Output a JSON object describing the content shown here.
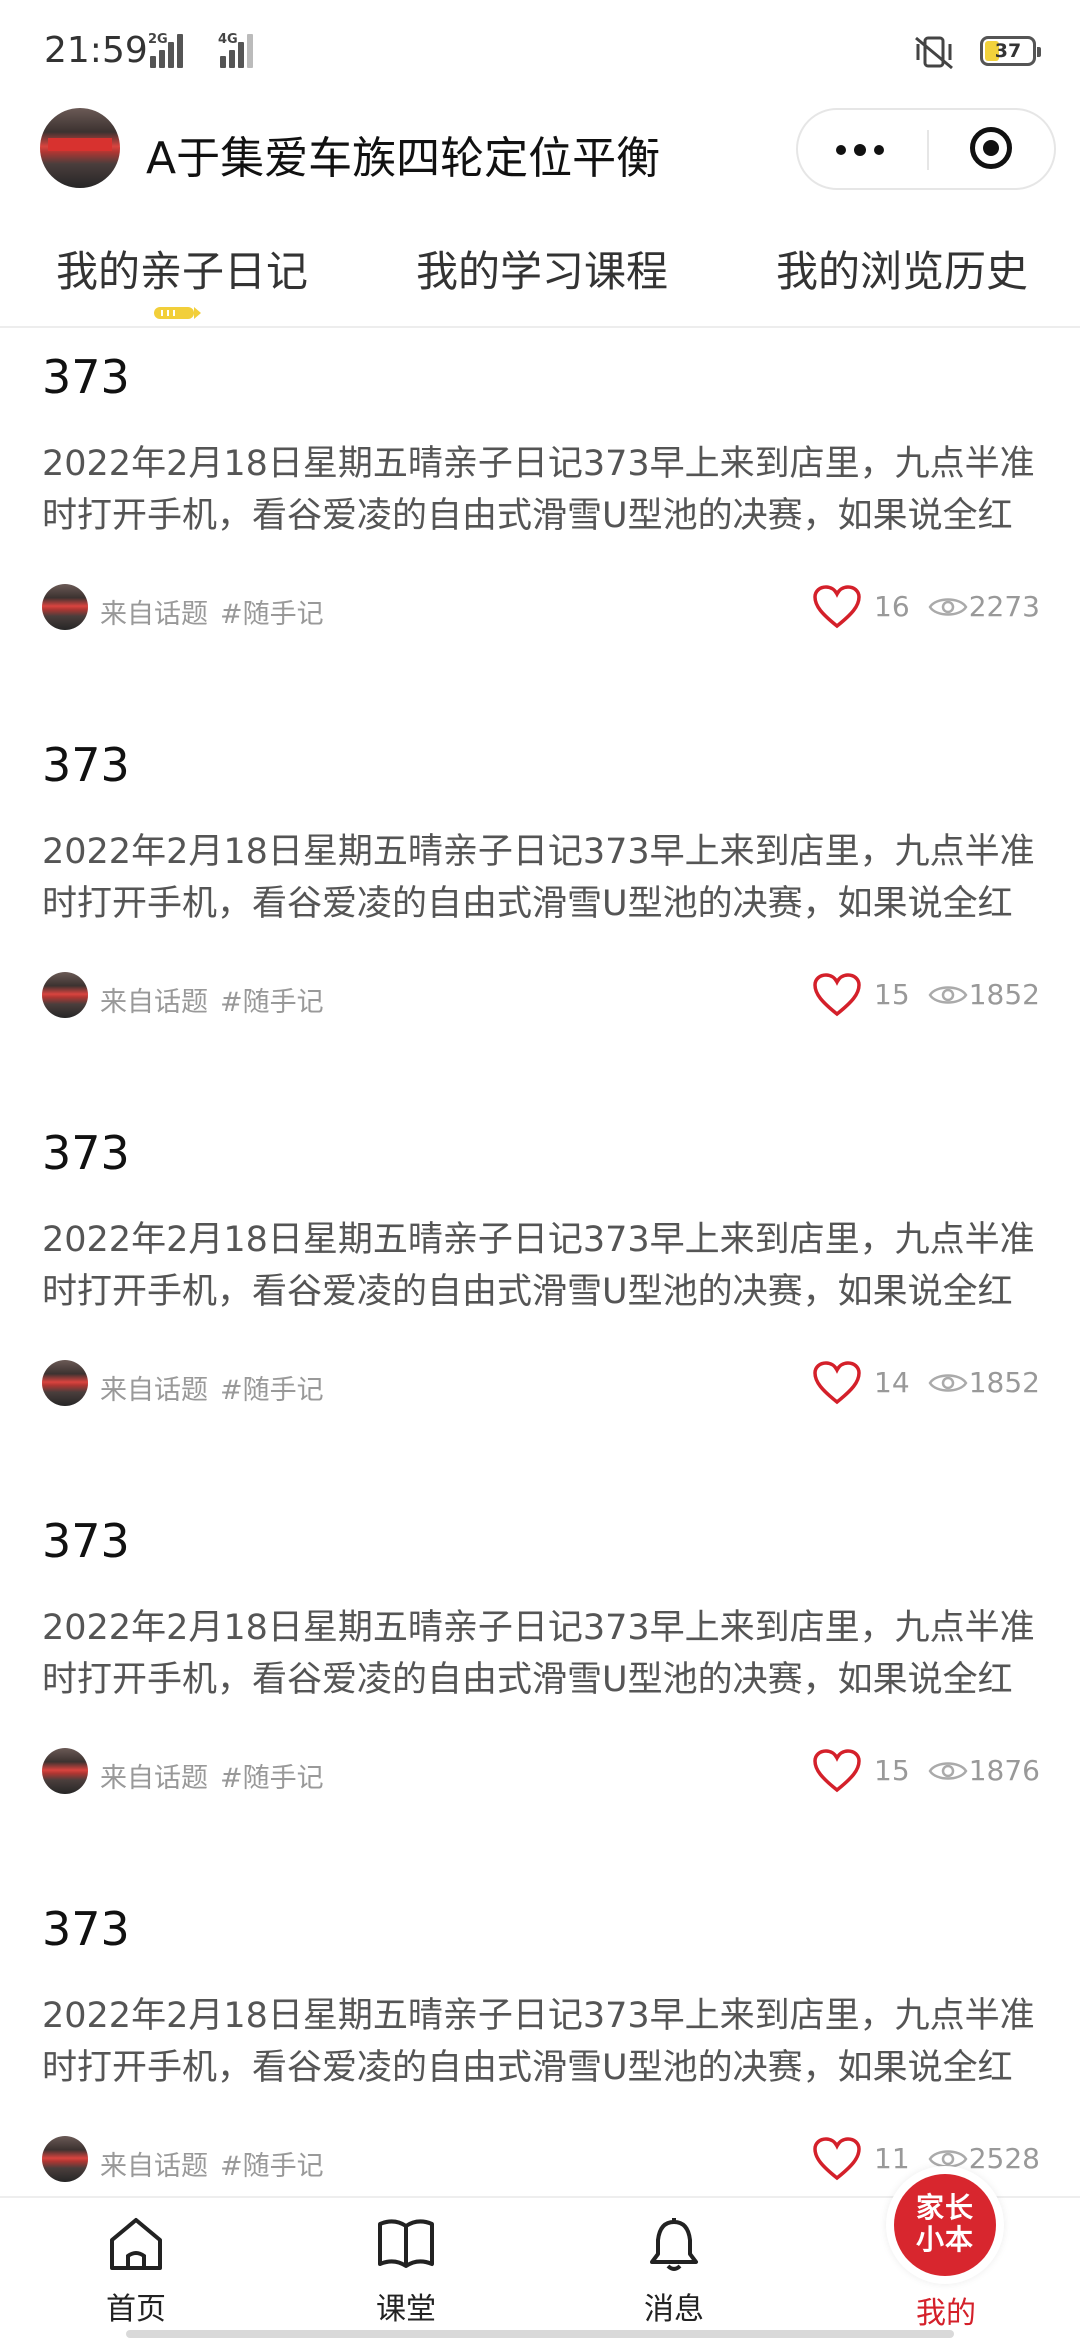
{
  "status_bar": {
    "time": "21:59",
    "network_1": "2G",
    "network_2": "4G",
    "battery": "37"
  },
  "header": {
    "title": "A于集爱车族四轮定位平衡"
  },
  "tabs": [
    {
      "label": "我的亲子日记",
      "active": true
    },
    {
      "label": "我的学习课程",
      "active": false
    },
    {
      "label": "我的浏览历史",
      "active": false
    }
  ],
  "posts": [
    {
      "title": "373",
      "excerpt": "2022年2月18日星期五晴亲子日记373早上来到店里，九点半准时打开手机，看谷爱凌的自由式滑雪U型池的决赛，如果说全红",
      "source": "来自话题",
      "topic": "#随手记",
      "likes": "16",
      "views": "2273"
    },
    {
      "title": "373",
      "excerpt": "2022年2月18日星期五晴亲子日记373早上来到店里，九点半准时打开手机，看谷爱凌的自由式滑雪U型池的决赛，如果说全红",
      "source": "来自话题",
      "topic": "#随手记",
      "likes": "15",
      "views": "1852"
    },
    {
      "title": "373",
      "excerpt": "2022年2月18日星期五晴亲子日记373早上来到店里，九点半准时打开手机，看谷爱凌的自由式滑雪U型池的决赛，如果说全红",
      "source": "来自话题",
      "topic": "#随手记",
      "likes": "14",
      "views": "1852"
    },
    {
      "title": "373",
      "excerpt": "2022年2月18日星期五晴亲子日记373早上来到店里，九点半准时打开手机，看谷爱凌的自由式滑雪U型池的决赛，如果说全红",
      "source": "来自话题",
      "topic": "#随手记",
      "likes": "15",
      "views": "1876"
    },
    {
      "title": "373",
      "excerpt": "2022年2月18日星期五晴亲子日记373早上来到店里，九点半准时打开手机，看谷爱凌的自由式滑雪U型池的决赛，如果说全红",
      "source": "来自话题",
      "topic": "#随手记",
      "likes": "11",
      "views": "2528"
    }
  ],
  "bottom_nav": [
    {
      "label": "首页",
      "icon": "home-icon"
    },
    {
      "label": "课堂",
      "icon": "book-icon"
    },
    {
      "label": "消息",
      "icon": "bell-icon"
    },
    {
      "label": "我的",
      "icon": "brand-logo",
      "active": true
    }
  ],
  "brand": {
    "line1": "家长",
    "line2": "小本"
  },
  "colors": {
    "accent": "#d4202a",
    "tab_indicator": "#f2cf3a",
    "text_muted": "#999999"
  }
}
